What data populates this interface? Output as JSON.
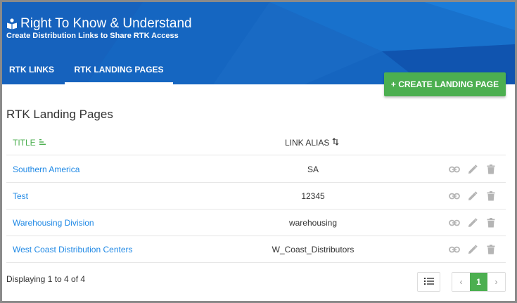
{
  "app": {
    "title": "Right To Know & Understand",
    "subtitle": "Create Distribution Links to Share RTK Access"
  },
  "tabs": [
    {
      "label": "RTK LINKS",
      "active": false
    },
    {
      "label": "RTK LANDING PAGES",
      "active": true
    }
  ],
  "actions": {
    "create_label": "+ CREATE LANDING PAGE"
  },
  "section": {
    "title": "RTK Landing Pages"
  },
  "table": {
    "columns": {
      "title": "TITLE",
      "alias": "LINK ALIAS"
    },
    "rows": [
      {
        "title": "Southern America",
        "alias": "SA"
      },
      {
        "title": "Test",
        "alias": "12345"
      },
      {
        "title": "Warehousing Division",
        "alias": "warehousing"
      },
      {
        "title": "West Coast Distribution Centers",
        "alias": "W_Coast_Distributors"
      }
    ],
    "row_actions": [
      "link-icon",
      "pencil-icon",
      "trash-icon"
    ]
  },
  "footer": {
    "displaying": "Displaying 1 to 4 of 4"
  },
  "pagination": {
    "prev": "‹",
    "current": "1",
    "next": "›"
  },
  "colors": {
    "header": "#1565c0",
    "accent_green": "#4caf50",
    "link_blue": "#1e88e5"
  }
}
